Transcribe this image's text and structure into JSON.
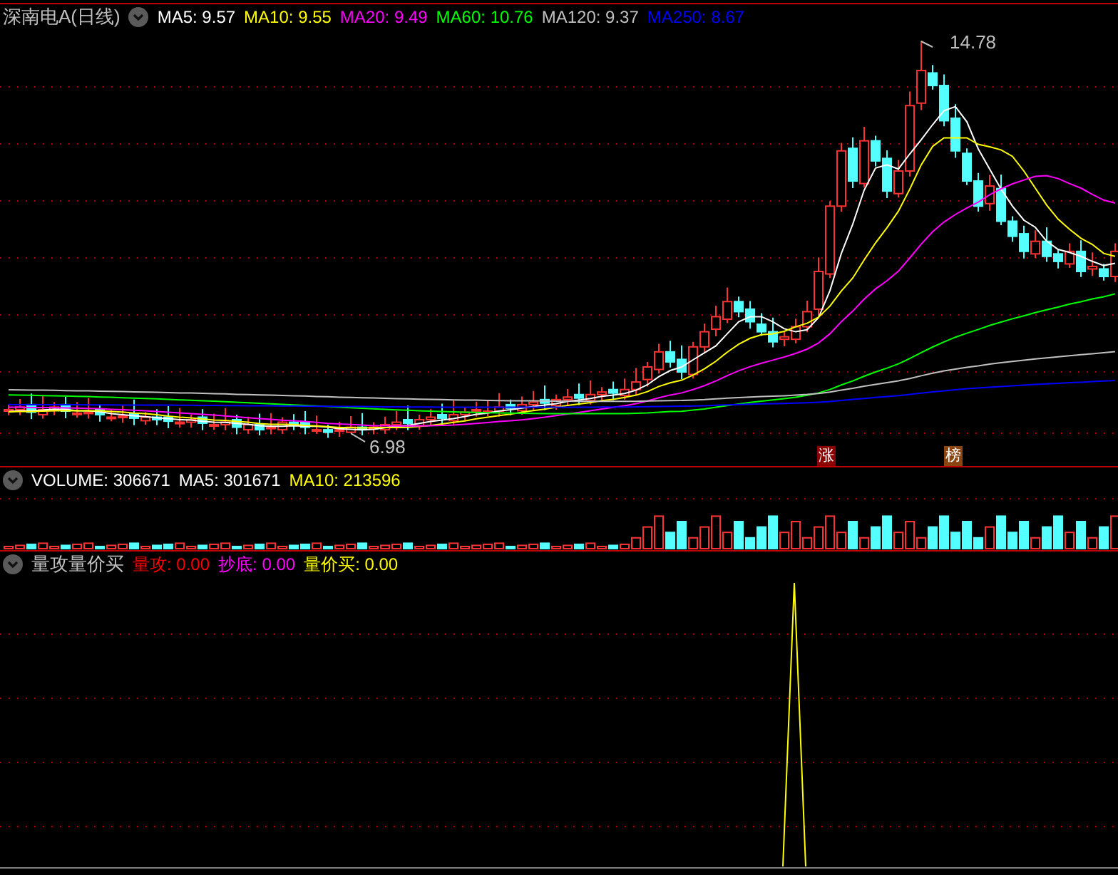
{
  "main_chart": {
    "title": "深南电A(日线)",
    "indicators": [
      {
        "text": "MA5: 9.57",
        "color": "#ffffff"
      },
      {
        "text": "MA10: 9.55",
        "color": "#ffff00"
      },
      {
        "text": "MA20: 9.49",
        "color": "#ff00ff"
      },
      {
        "text": "MA60: 10.76",
        "color": "#00ff00"
      },
      {
        "text": "MA120: 9.37",
        "color": "#c0c0c0"
      },
      {
        "text": "MA250: 8.67",
        "color": "#0000ff"
      }
    ],
    "high_label": "14.78",
    "low_label": "6.98",
    "badges": [
      {
        "text": "涨",
        "color": "#8b0000"
      },
      {
        "text": "榜",
        "color": "#8b4513"
      }
    ]
  },
  "volume_panel": {
    "indicators": [
      {
        "text": "VOLUME: 306671",
        "color": "#ffffff"
      },
      {
        "text": "MA5: 301671",
        "color": "#ffffff"
      },
      {
        "text": "MA10: 213596",
        "color": "#ffff00"
      }
    ]
  },
  "indicator_panel": {
    "title": "量攻量价买",
    "indicators": [
      {
        "text": "量攻: 0.00",
        "color": "#ff0000"
      },
      {
        "text": "抄底: 0.00",
        "color": "#ff00ff"
      },
      {
        "text": "量价买: 0.00",
        "color": "#ffff00"
      }
    ]
  }
}
